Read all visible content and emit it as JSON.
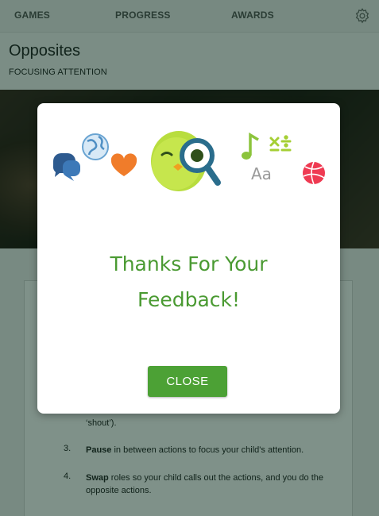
{
  "nav": {
    "tabs": [
      {
        "label": "GAMES"
      },
      {
        "label": "PROGRESS"
      },
      {
        "label": "AWARDS"
      }
    ],
    "settings_icon": "gear-icon"
  },
  "header": {
    "title": "Opposites",
    "subtitle": "FOCUSING ATTENTION"
  },
  "content": {
    "step2_tail": "‘shout’).",
    "steps": [
      {
        "number": "3.",
        "bold": "Pause",
        "text": " in between actions to focus your child's attention."
      },
      {
        "number": "4.",
        "bold": "Swap",
        "text": " roles so your child calls out the actions, and you do the opposite actions."
      }
    ]
  },
  "modal": {
    "message_line1": "Thanks For Your",
    "message_line2": "Feedback!",
    "close_label": "CLOSE",
    "illustration_text": "Aa",
    "icons": [
      "chat-icon",
      "globe-icon",
      "heart-icon",
      "owl-magnifier-icon",
      "music-note-icon",
      "math-symbols-icon",
      "basketball-icon"
    ]
  },
  "colors": {
    "accent_green": "#4ca135",
    "message_green": "#4a9a32"
  }
}
